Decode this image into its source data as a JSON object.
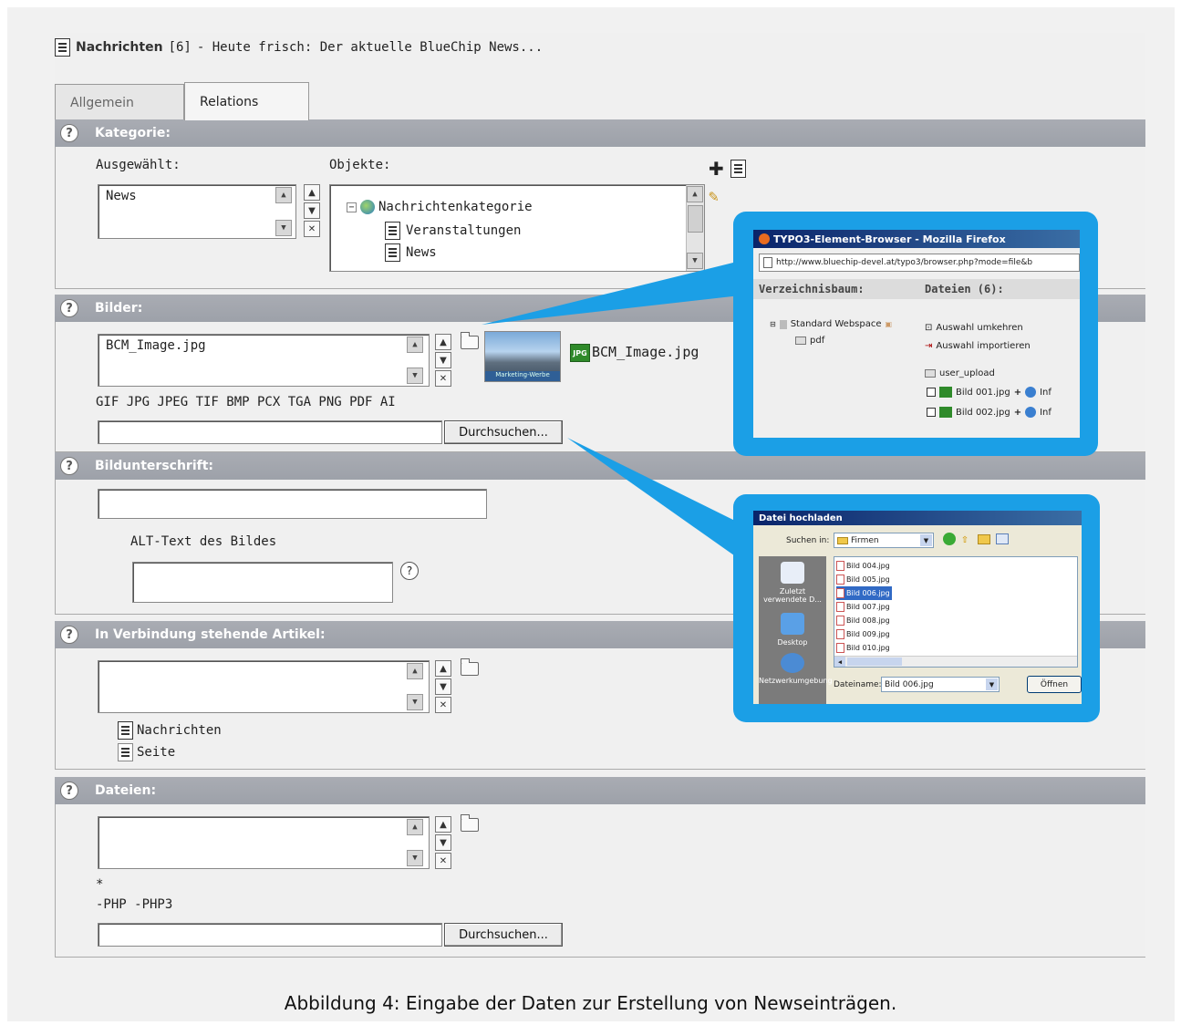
{
  "header": {
    "title": "Nachrichten",
    "id": "[6]",
    "subtitle": "- Heute frisch: Der aktuelle BlueChip News..."
  },
  "tabs": [
    {
      "label": "Allgemein"
    },
    {
      "label": "Relations"
    }
  ],
  "kategorie": {
    "title": "Kategorie:",
    "selected_label": "Ausgewählt:",
    "objects_label": "Objekte:",
    "selected_items": [
      "News"
    ],
    "tree_root": "Nachrichtenkategorie",
    "tree_children": [
      "Veranstaltungen",
      "News"
    ]
  },
  "bilder": {
    "title": "Bilder:",
    "file": "BCM_Image.jpg",
    "thumb_label": "BCM_Image.jpg",
    "thumb_caption": "Marketing-Werbe",
    "badge": "JPG",
    "allowed_types": "GIF JPG JPEG TIF BMP PCX TGA PNG PDF AI",
    "browse_label": "Durchsuchen..."
  },
  "bildunterschrift": {
    "title": "Bildunterschrift:",
    "alt_label": "ALT-Text des Bildes"
  },
  "verbindung": {
    "title": "In Verbindung stehende Artikel:",
    "links": [
      "Nachrichten",
      "Seite"
    ]
  },
  "dateien": {
    "title": "Dateien:",
    "star": "*",
    "excluded": "-PHP -PHP3",
    "browse_label": "Durchsuchen..."
  },
  "element_browser": {
    "title": "TYPO3-Element-Browser - Mozilla Firefox",
    "url": "http://www.bluechip-devel.at/typo3/browser.php?mode=file&b",
    "tree_header": "Verzeichnisbaum:",
    "files_header": "Dateien (6):",
    "root": "Standard Webspace",
    "folder": "pdf",
    "action1": "Auswahl umkehren",
    "action2": "Auswahl importieren",
    "upload_folder": "user_upload",
    "files": [
      "Bild 001.jpg",
      "Bild 002.jpg"
    ],
    "info_label": "Inf"
  },
  "upload_dialog": {
    "title": "Datei hochladen",
    "search_label": "Suchen in:",
    "folder": "Firmen",
    "sidebar": [
      "Zuletzt verwendete D...",
      "Desktop",
      "Netzwerkumgebung"
    ],
    "files": [
      "Bild 004.jpg",
      "Bild 005.jpg",
      "Bild 006.jpg",
      "Bild 007.jpg",
      "Bild 008.jpg",
      "Bild 009.jpg",
      "Bild 010.jpg"
    ],
    "selected_file": "Bild 006.jpg",
    "filename_label": "Dateiname:",
    "filename_value": "Bild 006.jpg",
    "open_label": "Öffnen"
  },
  "caption": "Abbildung 4: Eingabe der Daten zur Erstellung von Newseinträgen."
}
